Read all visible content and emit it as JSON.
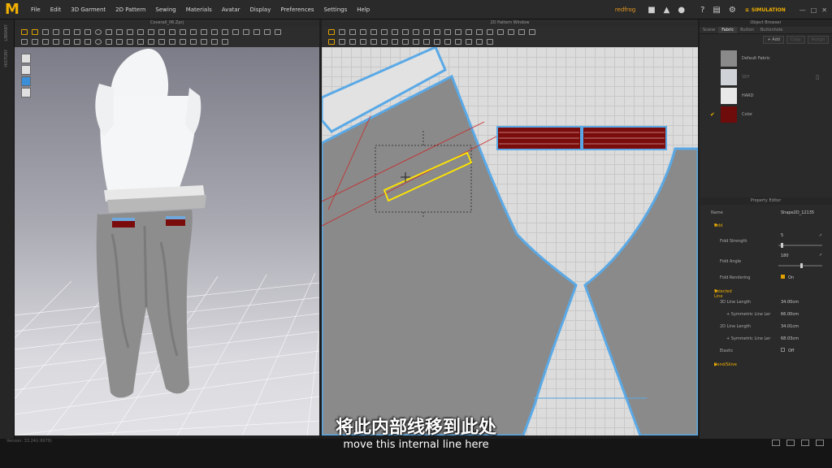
{
  "menubar": {
    "logo": "M",
    "items": [
      "File",
      "Edit",
      "3D Garment",
      "2D Pattern",
      "Sewing",
      "Materials",
      "Avatar",
      "Display",
      "Preferences",
      "Settings",
      "Help"
    ],
    "user": "redfrog",
    "simulation_label": "SIMULATION"
  },
  "left_strip": {
    "labels": [
      "LIBRARY",
      "HISTORY"
    ]
  },
  "window_3d": {
    "title": "Coverall_06.Zprj"
  },
  "window_2d": {
    "title": "2D Pattern Window"
  },
  "object_browser": {
    "title": "Object Browser",
    "tabs": [
      "Scene",
      "Fabric",
      "Button",
      "Buttonhole"
    ],
    "active_tab": "Fabric",
    "actions": {
      "add": "+ Add",
      "copy": "Copy",
      "assign": "Assign"
    },
    "fabrics": [
      {
        "name": "Default Fabric",
        "color": "#8a8a8a"
      },
      {
        "name": "SEP",
        "color": "#cfd3d8"
      },
      {
        "name": "HARD",
        "color": "#e8e8e8"
      },
      {
        "name": "Color",
        "color": "#6e0b0b"
      }
    ]
  },
  "property_editor": {
    "title": "Property Editor",
    "name_label": "Name",
    "name_value": "Shape2D_12135",
    "fold_section": "Fold",
    "fold_strength_label": "Fold Strength",
    "fold_strength_value": "5",
    "fold_strength_fraction": 0.06,
    "fold_angle_label": "Fold Angle",
    "fold_angle_value": "180",
    "fold_angle_fraction": 0.5,
    "fold_rendering_label": "Fold Rendering",
    "fold_rendering_value": "On",
    "selected_line_section": "Selected Line",
    "line_length_3d_label": "3D Line Length",
    "line_length_3d_value": "34.00cm",
    "sym_line_1_label": "+ Symmetric Line Ler",
    "sym_line_1_value": "66.00cm",
    "line_length_2d_label": "2D Line Length",
    "line_length_2d_value": "34.01cm",
    "sym_line_2_label": "+ Symmetric Line Ler",
    "sym_line_2_value": "68.03cm",
    "elastic_label": "Elastic",
    "elastic_value": "Off",
    "bond_section": "Bond/Skive"
  },
  "status_bar": {
    "text": "Version: 33.24(r.9979)"
  },
  "subtitles": {
    "chinese": "将此内部线移到此处",
    "english": "move this internal line here"
  },
  "colors": {
    "accent": "#f0b000",
    "pattern_outline": "#5aa9e6",
    "selected_line": "#ffe600",
    "trim_red": "#7a0c0c"
  }
}
